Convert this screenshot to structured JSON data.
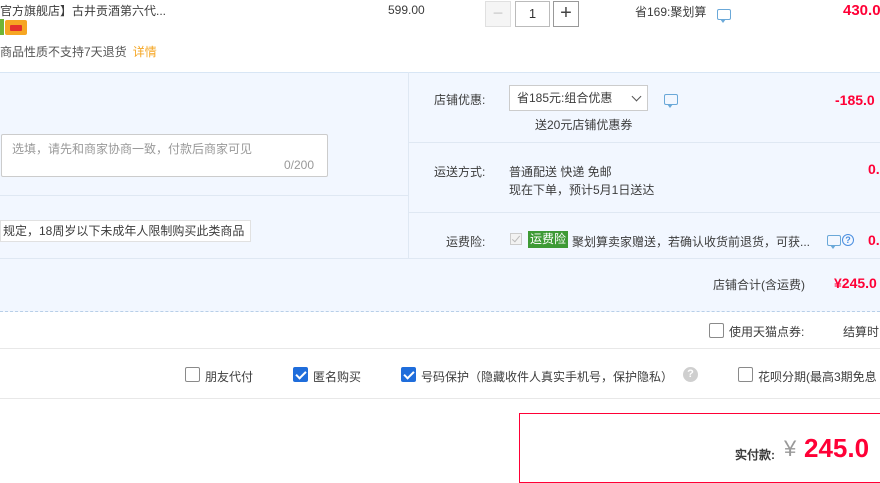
{
  "item": {
    "title": "官方旗舰店】古井贡酒第六代...",
    "no_return_text": "商品性质不支持7天退货",
    "detail_link": "详情",
    "unit_price": "599.00",
    "quantity": "1",
    "minus_label": "−",
    "plus_label": "+",
    "save_note": "省169:聚划算",
    "subtotal": "430.0"
  },
  "promo": {
    "label": "店铺优惠:",
    "selected": "省185元:组合优惠",
    "sub_note": "送20元店铺优惠券",
    "amount": "-185.0"
  },
  "message": {
    "placeholder": "选填，请先和商家协商一致，付款后商家可见",
    "counter": "0/200"
  },
  "shipping": {
    "label": "运送方式:",
    "line1": "普通配送 快递 免邮",
    "line2": "现在下单，预计5月1日送达",
    "amount": "0."
  },
  "age_notice": "规定，18周岁以下未成年人限制购买此类商品",
  "insurance": {
    "label": "运费险:",
    "tag": "运费险",
    "desc": "聚划算卖家赠送，若确认收货前退货，可获...",
    "amount": "0."
  },
  "store_total": {
    "label": "店铺合计(含运费)",
    "amount": "¥245.0"
  },
  "coupon": {
    "label": "使用天猫点券:",
    "settle_note": "结算时"
  },
  "options": {
    "friend_pay": "朋友代付",
    "anonymous": "匿名购买",
    "number_protect": "号码保护（隐藏收件人真实手机号，保护隐私）",
    "huabei": "花呗分期(最高3期免息"
  },
  "payment": {
    "label": "实付款:",
    "currency": "¥",
    "amount": "245.0"
  },
  "colors": {
    "price_red": "#ff0036",
    "check_blue": "#1f6ddb",
    "promo_bg": "#f2f7ff",
    "insurance_green": "#3d9a35"
  }
}
